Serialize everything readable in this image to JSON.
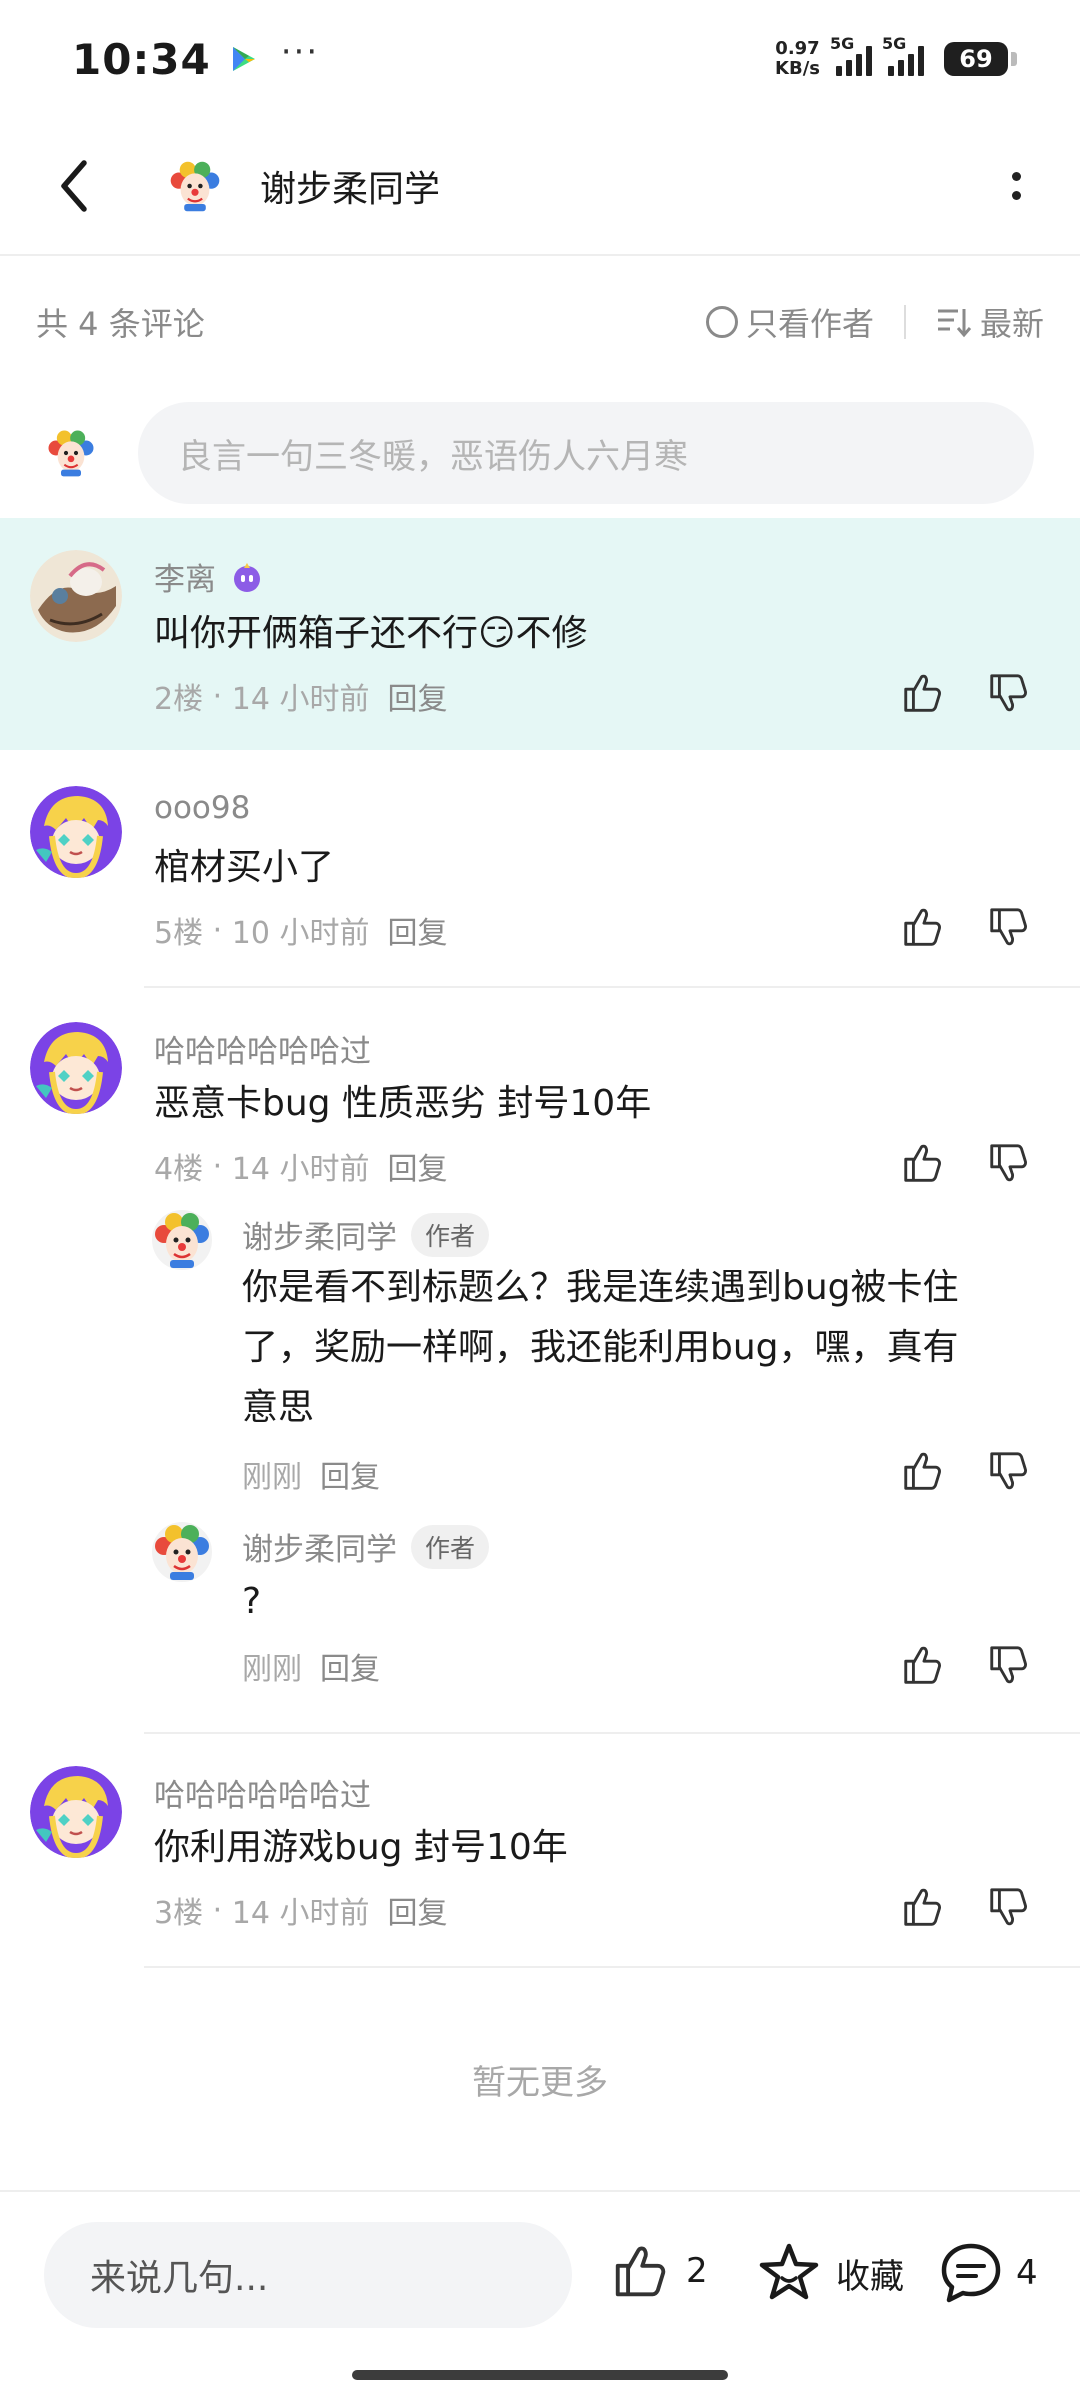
{
  "status_bar": {
    "time": "10:34",
    "more": "···",
    "net_speed_value": "0.97",
    "net_speed_unit": "KB/s",
    "sim1": "5G",
    "sim2": "5G",
    "battery": "69"
  },
  "header": {
    "title": "谢步柔同学"
  },
  "filter": {
    "count": "共 4 条评论",
    "author_only": "只看作者",
    "sort": "最新"
  },
  "input": {
    "placeholder": "良言一句三冬暖，恶语伤人六月寒"
  },
  "comments": [
    {
      "name": "李离",
      "text": "叫你开俩箱子还不行😏不修",
      "floor": "2楼",
      "time": "14 小时前",
      "reply": "回复"
    },
    {
      "name": "ooo98",
      "text": "棺材买小了",
      "floor": "5楼",
      "time": "10 小时前",
      "reply": "回复"
    },
    {
      "name": "哈哈哈哈哈哈过",
      "text": "恶意卡bug 性质恶劣 封号10年",
      "floor": "4楼",
      "time": "14 小时前",
      "reply": "回复",
      "replies": [
        {
          "name": "谢步柔同学",
          "tag": "作者",
          "text_line1": "你是看不到标题么？我是连续遇到bug被卡住",
          "text_line2": "了，奖励一样啊，我还能利用bug，嘿，真有",
          "text_line3": "意思",
          "time": "刚刚",
          "reply": "回复"
        },
        {
          "name": "谢步柔同学",
          "tag": "作者",
          "text": "?",
          "time": "刚刚",
          "reply": "回复"
        }
      ]
    },
    {
      "name": "哈哈哈哈哈哈过",
      "text": "你利用游戏bug 封号10年",
      "floor": "3楼",
      "time": "14 小时前",
      "reply": "回复"
    }
  ],
  "meta_sep": "·",
  "no_more": "暂无更多",
  "bottom_bar": {
    "input_placeholder": "来说几句...",
    "like_count": "2",
    "favorite_label": "收藏",
    "comment_count": "4"
  }
}
